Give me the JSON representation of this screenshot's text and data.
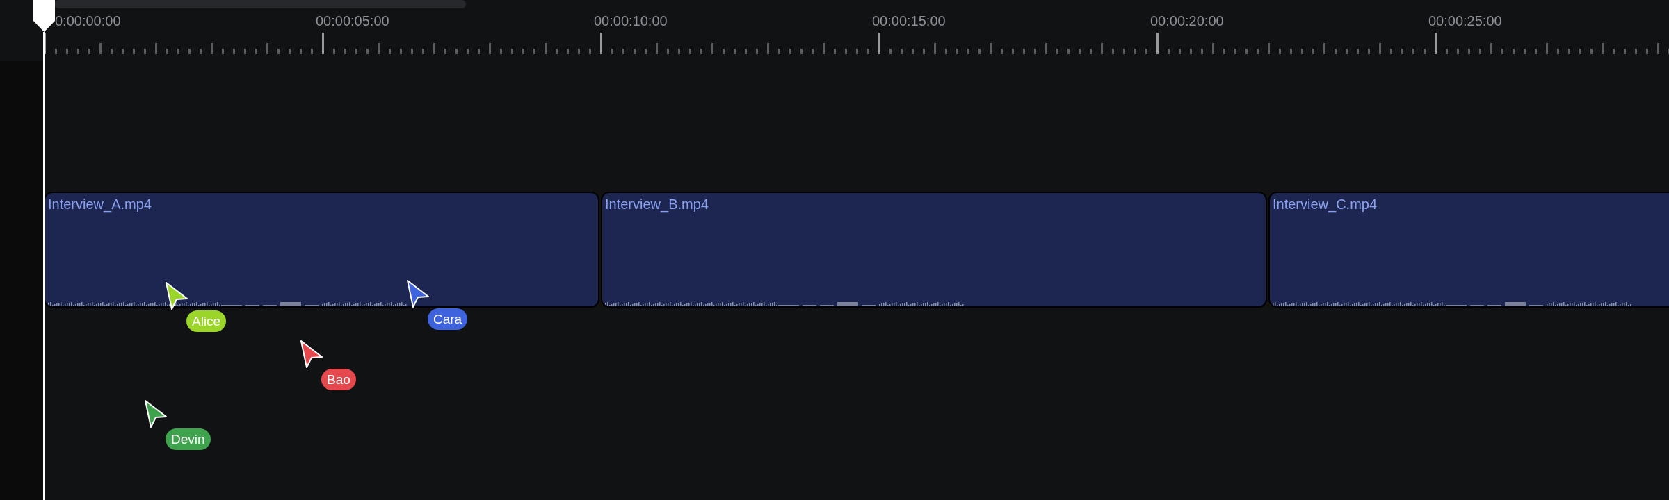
{
  "ruler": {
    "labels": [
      "0:00:00:00",
      "00:00:05:00",
      "00:00:10:00",
      "00:00:15:00",
      "00:00:20:00",
      "00:00:25:00"
    ]
  },
  "clips": [
    {
      "name": "Interview_A.mp4"
    },
    {
      "name": "Interview_B.mp4"
    },
    {
      "name": "Interview_C.mp4"
    }
  ],
  "cursors": [
    {
      "name": "Alice",
      "color": "#9bd52a"
    },
    {
      "name": "Cara",
      "color": "#3e63dd"
    },
    {
      "name": "Bao",
      "color": "#e5484d"
    },
    {
      "name": "Devin",
      "color": "#3fa34d"
    }
  ]
}
